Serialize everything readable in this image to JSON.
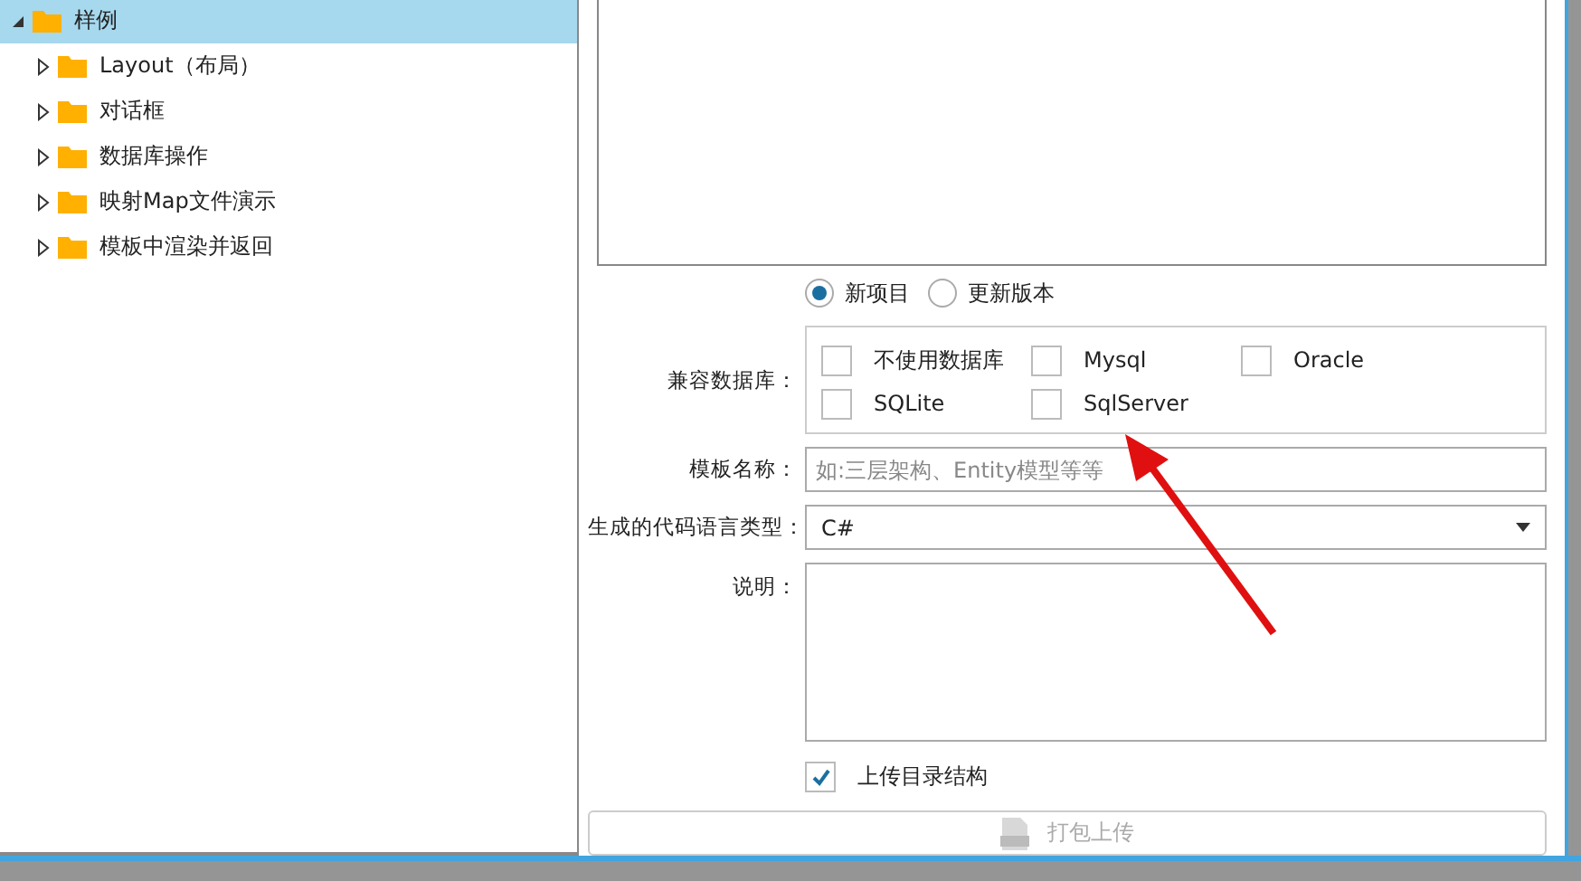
{
  "tree": {
    "label": "样例",
    "expanded": true,
    "selected": true,
    "children": [
      {
        "label": "Layout（布局）",
        "expanded": false,
        "selected": false
      },
      {
        "label": "对话框",
        "expanded": false,
        "selected": false
      },
      {
        "label": "数据库操作",
        "expanded": false,
        "selected": false
      },
      {
        "label": "映射Map文件演示",
        "expanded": false,
        "selected": false
      },
      {
        "label": "模板中渲染并返回",
        "expanded": false,
        "selected": false
      }
    ]
  },
  "form": {
    "mode_options": [
      {
        "label": "新项目",
        "selected": true
      },
      {
        "label": "更新版本",
        "selected": false
      }
    ],
    "databases": {
      "label": "兼容数据库：",
      "options": [
        {
          "label": "不使用数据库",
          "checked": false
        },
        {
          "label": "Mysql",
          "checked": false
        },
        {
          "label": "Oracle",
          "checked": false
        },
        {
          "label": "SQLite",
          "checked": false
        },
        {
          "label": "SqlServer",
          "checked": false
        }
      ]
    },
    "template_name": {
      "label": "模板名称：",
      "placeholder": "如:三层架构、Entity模型等等"
    },
    "language": {
      "label": "生成的代码语言类型：",
      "value": "C#"
    },
    "description": {
      "label": "说明："
    },
    "upload_structure": {
      "label": "上传目录结构",
      "checked": true
    },
    "pack_button": {
      "label": "打包上传",
      "disabled": true
    }
  }
}
